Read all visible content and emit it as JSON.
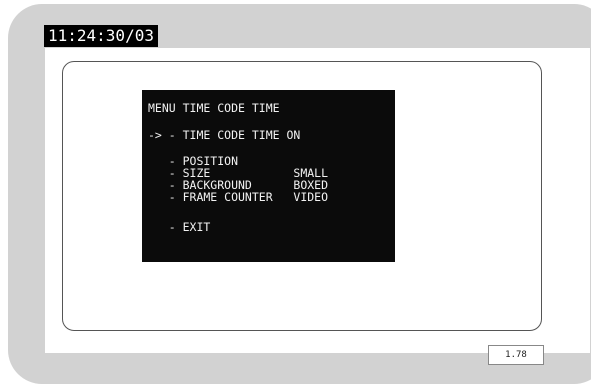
{
  "timecode": {
    "display": "11:24:30/03"
  },
  "menu": {
    "title": "MENU TIME CODE TIME",
    "selected_line": "-> - TIME CODE TIME ON",
    "position_line": "   - POSITION",
    "size_line": "   - SIZE            SMALL",
    "background_line": "   - BACKGROUND      BOXED",
    "frame_counter_line": "   - FRAME COUNTER   VIDEO",
    "exit_line": "   - EXIT"
  },
  "aspect_ratio": "1.78"
}
